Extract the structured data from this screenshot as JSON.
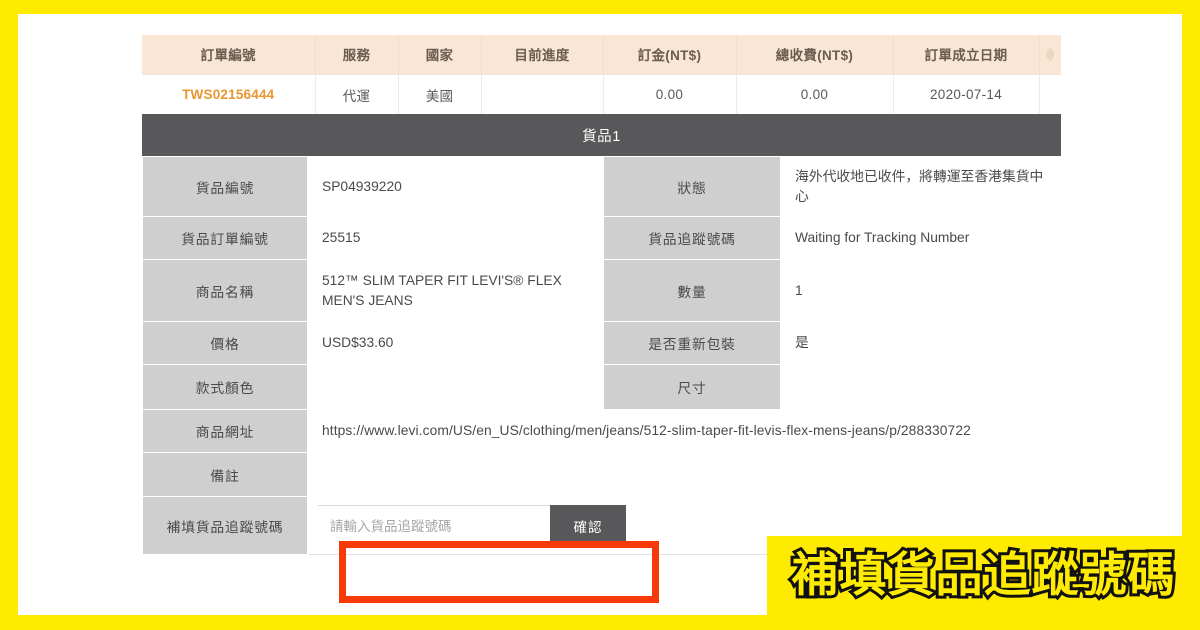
{
  "frame": {
    "border_color": "#ffeb00",
    "page_background": "#ffffff"
  },
  "order_table": {
    "headers": [
      "訂單編號",
      "服務",
      "國家",
      "目前進度",
      "訂金(NT$)",
      "總收費(NT$)",
      "訂單成立日期"
    ],
    "sort_icon": "sort-diamond-icon",
    "row": {
      "order_id": "TWS02156444",
      "service": "代運",
      "country": "美國",
      "progress": "",
      "deposit": "0.00",
      "total_fee": "0.00",
      "created_date": "2020-07-14"
    },
    "header_bg": "#fae6d4",
    "order_id_color": "#e8972f"
  },
  "item_panel": {
    "title": "貨品1",
    "title_bg": "#58585a",
    "label_bg": "#cfcfcf",
    "rows": [
      {
        "left_label": "貨品編號",
        "left_value": "SP04939220",
        "right_label": "狀態",
        "right_value": "海外代收地已收件，將轉運至香港集貨中心"
      },
      {
        "left_label": "貨品訂單編號",
        "left_value": "25515",
        "right_label": "貨品追蹤號碼",
        "right_value": "Waiting for Tracking Number"
      },
      {
        "left_label": "商品名稱",
        "left_value": "512™ SLIM TAPER FIT LEVI'S® FLEX MEN'S JEANS",
        "right_label": "數量",
        "right_value": "1"
      },
      {
        "left_label": "價格",
        "left_value": "USD$33.60",
        "right_label": "是否重新包裝",
        "right_value": "是"
      },
      {
        "left_label": "款式顏色",
        "left_value": "",
        "right_label": "尺寸",
        "right_value": ""
      }
    ],
    "url_row": {
      "label": "商品網址",
      "value": "https://www.levi.com/US/en_US/clothing/men/jeans/512-slim-taper-fit-levis-flex-mens-jeans/p/288330722"
    },
    "note_row": {
      "label": "備註",
      "value": ""
    },
    "tracking_row": {
      "label": "補填貨品追蹤號碼",
      "input_value": "",
      "input_placeholder": "請輸入貨品追蹤號碼",
      "confirm_label": "確認"
    }
  },
  "annotation": {
    "highlight_color": "#f63a0a",
    "caption": "補填貨品追蹤號碼",
    "caption_bg": "#ffeb00",
    "caption_stroke": "#111111"
  }
}
